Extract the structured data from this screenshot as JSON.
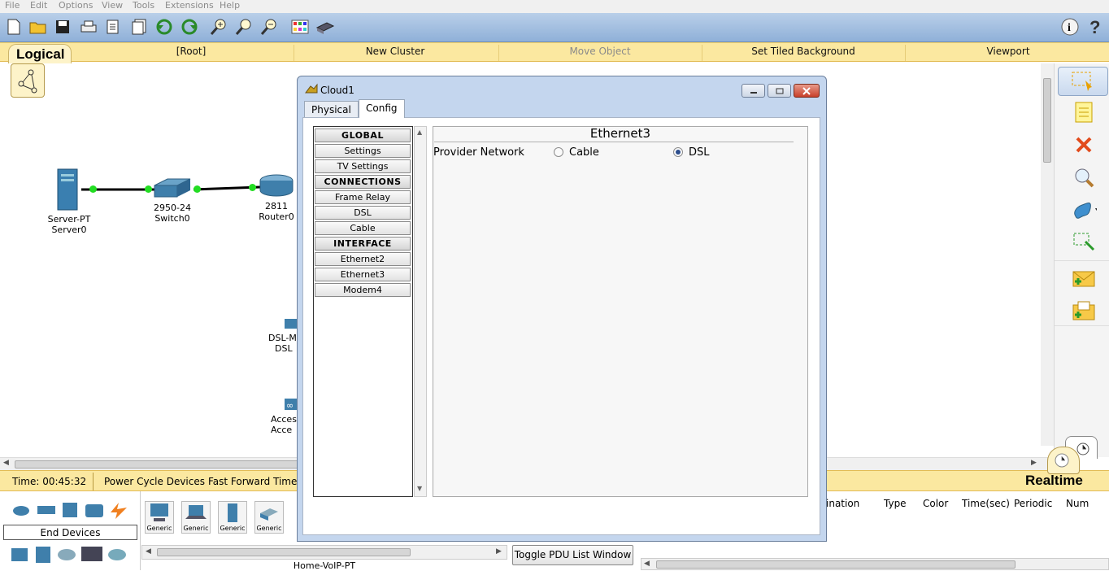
{
  "menu": [
    "File",
    "Edit",
    "Options",
    "View",
    "Tools",
    "Extensions",
    "Help"
  ],
  "logical_bar": {
    "tab": "Logical",
    "root": "[Root]",
    "new_cluster": "New Cluster",
    "move_object": "Move Object",
    "set_tiled_background": "Set Tiled Background",
    "viewport": "Viewport"
  },
  "devices": {
    "server": {
      "model": "Server-PT",
      "name": "Server0"
    },
    "switch": {
      "model": "2950-24",
      "name": "Switch0"
    },
    "router": {
      "model": "2811",
      "name": "Router0"
    },
    "dsl_partial_1": "DSL-M",
    "dsl_partial_2": "DSL",
    "access_partial_1": "Acces",
    "access_partial_2": "Acce"
  },
  "dialog": {
    "title": "Cloud1",
    "tabs": [
      "Physical",
      "Config"
    ],
    "active_tab": "Config",
    "sidebar": [
      {
        "label": "GLOBAL",
        "header": true
      },
      {
        "label": "Settings",
        "header": false
      },
      {
        "label": "TV Settings",
        "header": false
      },
      {
        "label": "CONNECTIONS",
        "header": true
      },
      {
        "label": "Frame Relay",
        "header": false
      },
      {
        "label": "DSL",
        "header": false
      },
      {
        "label": "Cable",
        "header": false
      },
      {
        "label": "INTERFACE",
        "header": true
      },
      {
        "label": "Ethernet2",
        "header": false
      },
      {
        "label": "Ethernet3",
        "header": false
      },
      {
        "label": "Modem4",
        "header": false
      }
    ],
    "panel": {
      "title": "Ethernet3",
      "provider_label": "Provider Network",
      "option_cable": "Cable",
      "option_dsl": "DSL",
      "selected": "DSL"
    }
  },
  "status": {
    "time": "Time: 00:45:32",
    "power_cycle": "Power Cycle Devices",
    "fast_forward": "Fast Forward Time",
    "realtime": "Realtime"
  },
  "bottom": {
    "category_label": "End Devices",
    "generic_labels": [
      "Generic",
      "Generic",
      "Generic",
      "Generic"
    ],
    "device_name": "Home-VoIP-PT",
    "toggle_pdu": "Toggle PDU List Window",
    "pdu_columns": [
      "ination",
      "Type",
      "Color",
      "Time(sec)",
      "Periodic",
      "Num"
    ]
  },
  "colors": {
    "toolbar": "#9db9de",
    "logical_bar": "#fbe8a0",
    "link_dot": "#22dd22",
    "dialog_frame": "#c4d6ee"
  }
}
